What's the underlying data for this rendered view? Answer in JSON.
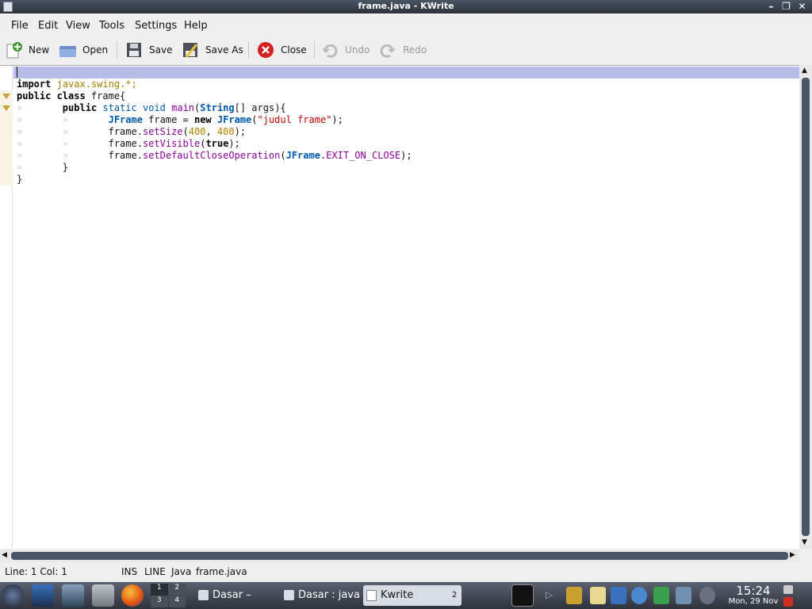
{
  "window": {
    "title": "frame.java - KWrite"
  },
  "menu": [
    "File",
    "Edit",
    "View",
    "Tools",
    "Settings",
    "Help"
  ],
  "toolbar": {
    "new": "New",
    "open": "Open",
    "save": "Save",
    "save_as": "Save As",
    "close": "Close",
    "undo": "Undo",
    "redo": "Redo"
  },
  "editor": {
    "language": "Java"
  },
  "status": {
    "position": "Line: 1 Col: 1",
    "mode": "INS",
    "selection": "LINE",
    "filetype": "Java",
    "filename": "frame.java"
  },
  "taskbar": {
    "tasks": [
      "Dasar – Dolphin",
      "Dasar : java",
      "Kwrite"
    ],
    "desktops": [
      "1",
      "2",
      "3",
      "4"
    ],
    "kwrite_count": "2",
    "time": "15:24",
    "date": "Mon, 29 Nov"
  },
  "colors": {
    "accent": "#b5bde8",
    "keyword": "#000000",
    "type": "#0057ae",
    "function": "#8d0099",
    "string": "#bf0303",
    "number": "#b08000",
    "package": "#9c7f00"
  }
}
